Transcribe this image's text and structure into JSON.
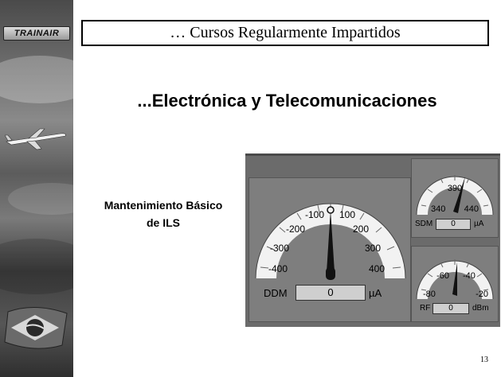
{
  "sidebar": {
    "logo_text": "TRAINAIR"
  },
  "title": "… Cursos Regularmente Impartidos",
  "subtitle": "...Electrónica y Telecomunicaciones",
  "caption_line1": "Mantenimiento Básico",
  "caption_line2": "de ILS",
  "page_number": "13",
  "instrument": {
    "ddm_gauge": {
      "ticks_left": [
        "-100",
        "-200",
        "-300",
        "-400"
      ],
      "ticks_right": [
        "100",
        "200",
        "300",
        "400"
      ],
      "label": "DDM",
      "value": "0",
      "unit": "µA"
    },
    "sdm_gauge": {
      "ticks": [
        "340",
        "390",
        "440"
      ],
      "label": "SDM",
      "value": "0",
      "unit": "µA"
    },
    "rf_gauge": {
      "ticks": [
        "-80",
        "-60",
        "-40",
        "-20"
      ],
      "label": "RF",
      "value": "0",
      "unit": "dBm"
    }
  }
}
